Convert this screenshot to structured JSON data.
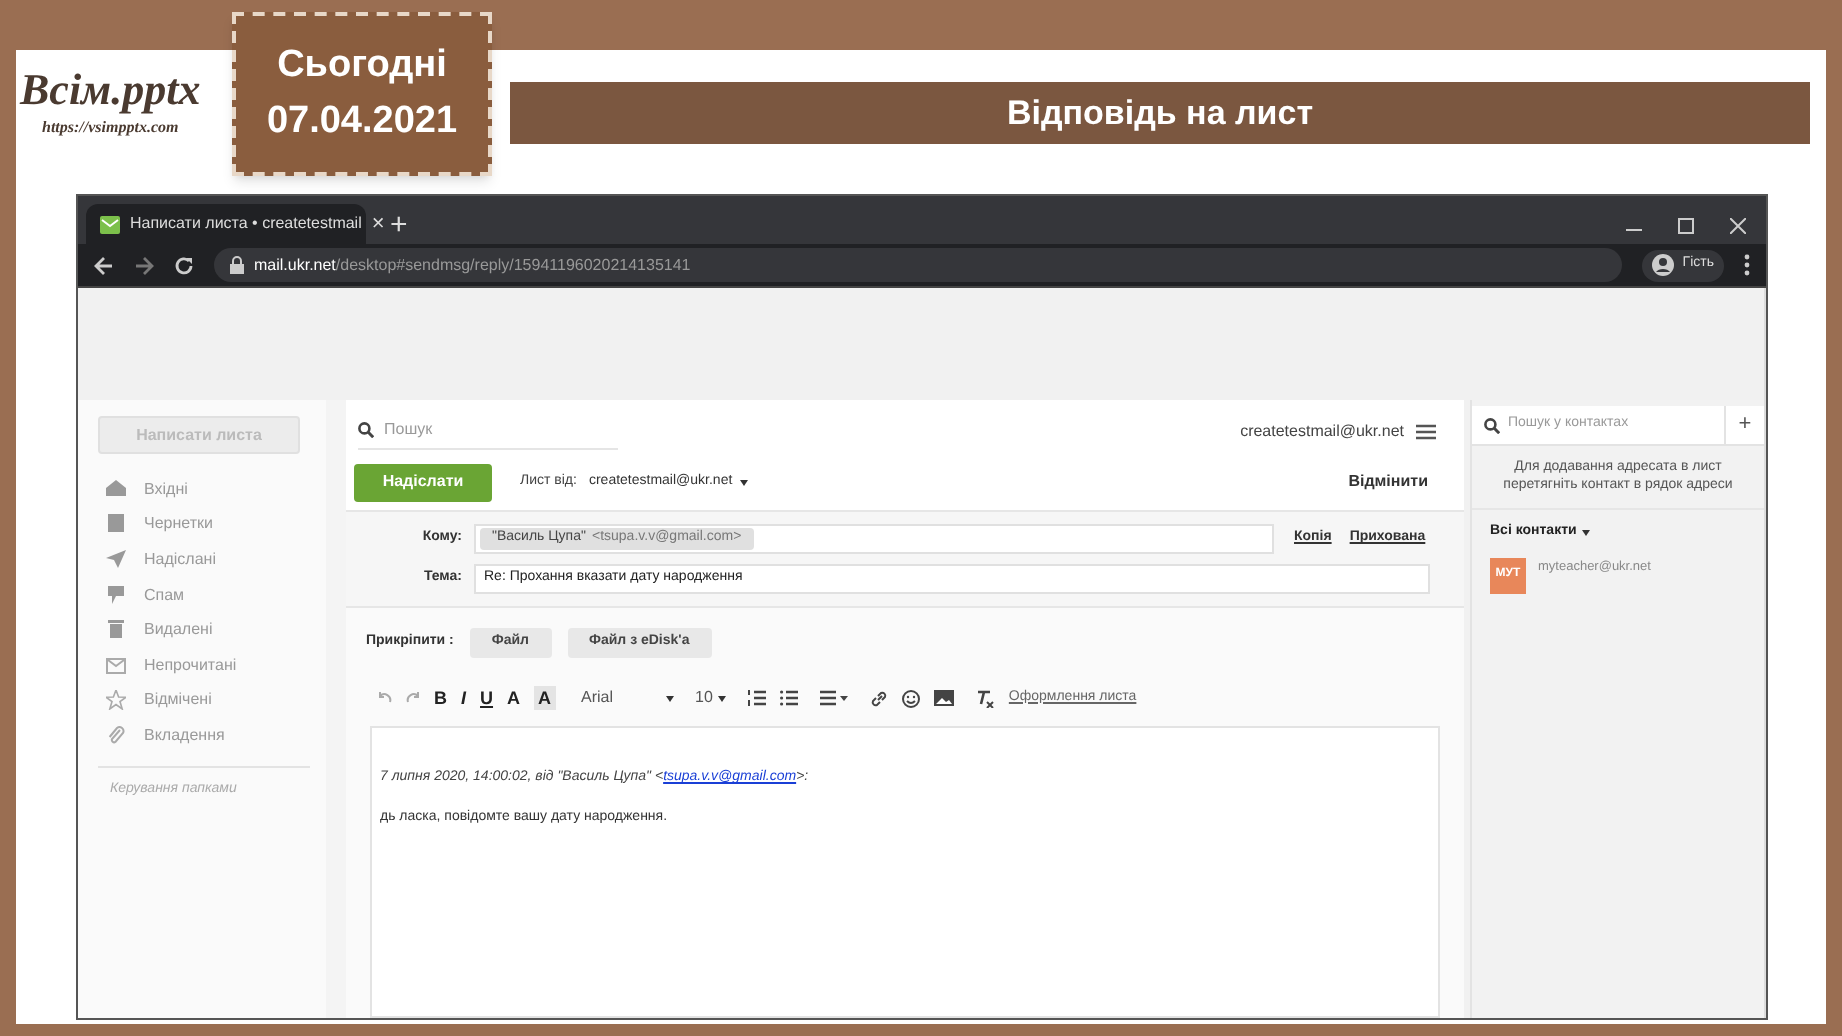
{
  "slide": {
    "logo": {
      "title": "Всім.pptx",
      "url": "https://vsimpptx.com"
    },
    "date_tab": {
      "label": "Сьогодні",
      "date": "07.04.2021"
    },
    "title": "Відповідь на лист"
  },
  "browser": {
    "tab": {
      "title": "Написати листа • createtestmail",
      "close": "×"
    },
    "new_tab": "+",
    "url": {
      "host": "mail.ukr.net",
      "path": "/desktop#sendmsg/reply/15941196020214135141"
    },
    "profile": "Гість"
  },
  "mail": {
    "compose_button": "Написати листа",
    "folders": [
      {
        "label": "Вхідні"
      },
      {
        "label": "Чернетки"
      },
      {
        "label": "Надіслані"
      },
      {
        "label": "Спам"
      },
      {
        "label": "Видалені"
      },
      {
        "label": "Непрочитані"
      },
      {
        "label": "Відмічені"
      },
      {
        "label": "Вкладення"
      }
    ],
    "manage_folders": "Керування папками",
    "search_placeholder": "Пошук",
    "account": "createtestmail@ukr.net",
    "send": "Надіслати",
    "from_label": "Лист від:",
    "from": "createtestmail@ukr.net",
    "cancel": "Відмінити",
    "to_label": "Кому:",
    "to_name": "\"Василь Цупа\"",
    "to_email": "<tsupa.v.v@gmail.com>",
    "cc": "Копія",
    "bcc": "Прихована",
    "subject_label": "Тема:",
    "subject": "Re: Прохання вказати дату народження",
    "attach_label": "Прикріпити :",
    "attach_buttons": [
      "Файл",
      "Файл з eDisk'a"
    ],
    "format_buttons": [
      {
        "kind": "bold",
        "label": "B"
      },
      {
        "kind": "italic",
        "label": "I"
      },
      {
        "kind": "underline",
        "label": "U"
      },
      {
        "kind": "color",
        "label": "A"
      },
      {
        "kind": "highlight",
        "label": "A"
      }
    ],
    "font": "Arial",
    "size": "10",
    "design": "Оформлення листа",
    "quote": {
      "before": "7 липня 2020, 14:00:02, від \"Василь Цупа\" <",
      "link": "tsupa.v.v@gmail.com",
      "after": ">:"
    },
    "body_line": "дь ласка, повідомте вашу дату народження."
  },
  "contacts": {
    "search_placeholder": "Пошук у контактах",
    "add": "+",
    "hint": "Для додавання адресата в лист перетягніть контакт в рядок адреси",
    "group": "Всі контакти",
    "items": [
      {
        "initials": "МУТ",
        "email": "myteacher@ukr.net",
        "color": "#e8875a"
      }
    ]
  }
}
